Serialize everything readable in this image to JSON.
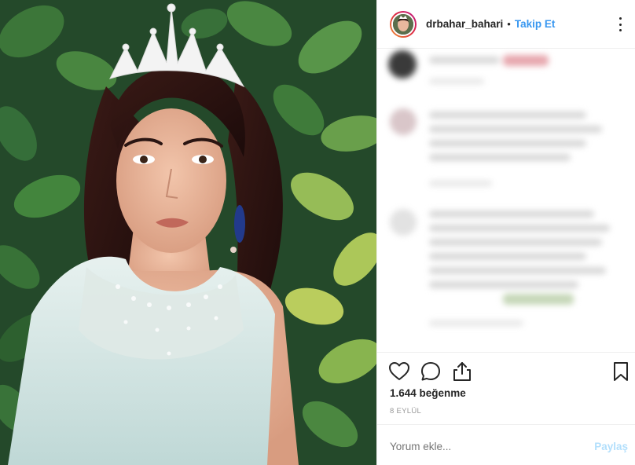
{
  "post": {
    "username": "drbahar_bahari",
    "separator": "•",
    "follow_label": "Takip Et",
    "likes": "1.644 beğenme",
    "date": "8 EYLÜL",
    "comment_placeholder": "Yorum ekle...",
    "share_label": "Paylaş"
  },
  "colors": {
    "accent": "#3897f0",
    "share_disabled": "#b2dffc",
    "text": "#262626",
    "muted": "#999999",
    "divider": "#efefef"
  },
  "icons": {
    "like": "heart-icon",
    "comment": "comment-icon",
    "share": "share-icon",
    "save": "bookmark-icon",
    "options": "more-options-icon"
  }
}
